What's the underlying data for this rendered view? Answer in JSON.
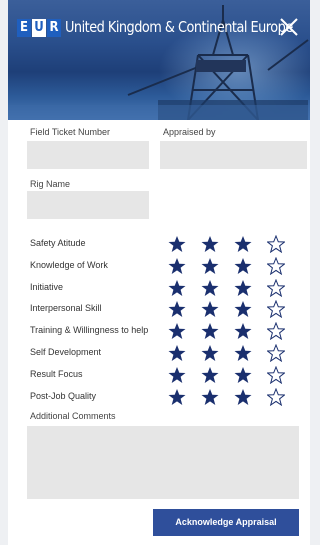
{
  "header": {
    "badge_e": "E",
    "badge_u": "U",
    "badge_r": "R",
    "title": "United Kingdom & Continental Europe",
    "close_icon": "close-icon"
  },
  "form": {
    "field_ticket_label": "Field Ticket Number",
    "appraised_by_label": "Appraised by",
    "rig_name_label": "Rig Name",
    "ratings": [
      {
        "label": "Safety Atitude",
        "stars": 3,
        "max": 4
      },
      {
        "label": "Knowledge of Work",
        "stars": 3,
        "max": 4
      },
      {
        "label": "Initiative",
        "stars": 3,
        "max": 4
      },
      {
        "label": "Interpersonal Skill",
        "stars": 3,
        "max": 4
      },
      {
        "label": "Training & Willingness to help",
        "stars": 3,
        "max": 4
      },
      {
        "label": "Self Development",
        "stars": 3,
        "max": 4
      },
      {
        "label": "Result Focus",
        "stars": 3,
        "max": 4
      },
      {
        "label": "Post-Job Quality",
        "stars": 3,
        "max": 4
      }
    ],
    "comments_label": "Additional Comments",
    "submit_label": "Acknowledge Appraisal"
  },
  "colors": {
    "star_filled": "#1a2f6e",
    "button": "#2f4f9b",
    "field": "#e6e6e6"
  }
}
